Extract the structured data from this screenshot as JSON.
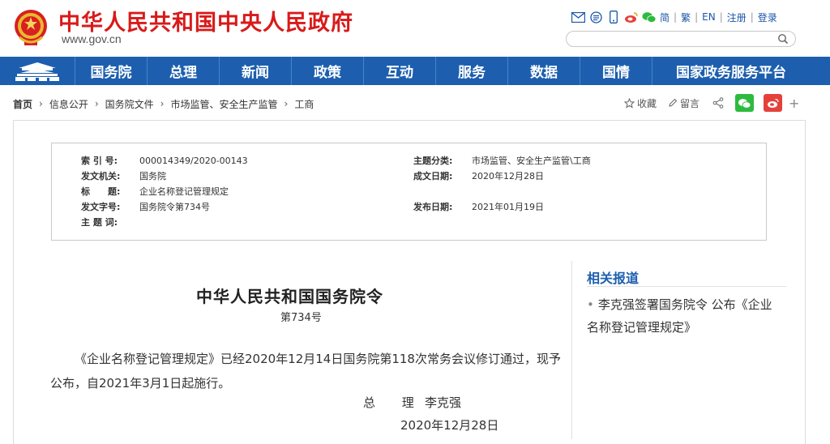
{
  "header": {
    "site_title": "中华人民共和国中央人民政府",
    "domain": "www.gov.cn",
    "tools": {
      "simplified": "简",
      "traditional": "繁",
      "english": "EN",
      "register": "注册",
      "login": "登录"
    },
    "search_placeholder": ""
  },
  "nav": {
    "items": [
      "国务院",
      "总理",
      "新闻",
      "政策",
      "互动",
      "服务",
      "数据",
      "国情",
      "国家政务服务平台"
    ]
  },
  "breadcrumb": {
    "items": [
      "首页",
      "信息公开",
      "国务院文件",
      "市场监管、安全生产监管",
      "工商"
    ]
  },
  "share": {
    "favorite": "收藏",
    "comment": "留言",
    "plus": "+"
  },
  "meta": {
    "index_label": "索 引 号:",
    "index_value": "000014349/2020-00143",
    "topic_label": "主题分类:",
    "topic_value": "市场监管、安全生产监管\\工商",
    "issuer_label": "发文机关:",
    "issuer_value": "国务院",
    "created_label": "成文日期:",
    "created_value": "2020年12月28日",
    "title_label": "标　　题:",
    "title_value": "企业名称登记管理规定",
    "docno_label": "发文字号:",
    "docno_value": "国务院令第734号",
    "published_label": "发布日期:",
    "published_value": "2021年01月19日",
    "keywords_label": "主 题 词:",
    "keywords_value": ""
  },
  "article": {
    "title": "中华人民共和国国务院令",
    "number": "第734号",
    "body": "《企业名称登记管理规定》已经2020年12月14日国务院第118次常务会议修订通过，现予公布，自2021年3月1日起施行。",
    "sign_role": "总 理",
    "sign_name": "李克强",
    "sign_date": "2020年12月28日"
  },
  "related": {
    "title": "相关报道",
    "items": [
      "李克强签署国务院令 公布《企业名称登记管理规定》"
    ]
  },
  "colors": {
    "brand_red": "#d91a1a",
    "nav_blue": "#1d5fae",
    "wechat_green": "#2dbb3e",
    "weibo_red": "#e5413b"
  }
}
